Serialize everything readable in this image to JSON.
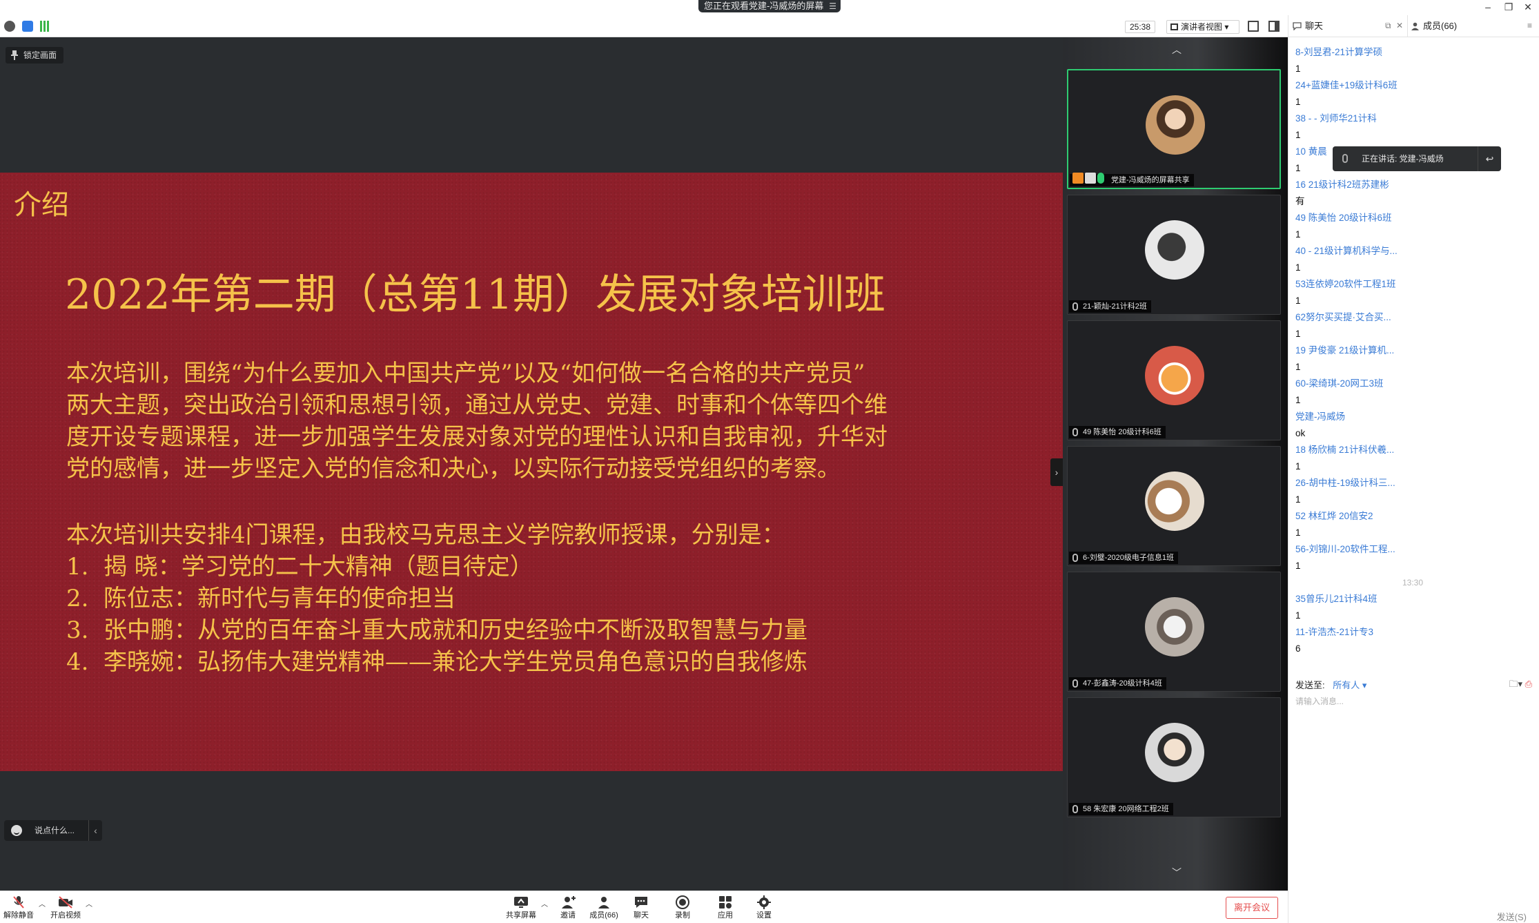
{
  "banner": {
    "text": "您正在观看党建-冯威炀的屏幕",
    "menu_icon": "hamburger-icon"
  },
  "toolbar": {
    "timer": "25:38",
    "view_label": "演讲者视图 ▾"
  },
  "stage": {
    "lock_label": "锁定画面",
    "chat_placeholder": "说点什么..."
  },
  "slide": {
    "heading": "介绍",
    "title": "2022年第二期（总第11期）发展对象培训班",
    "paragraph_lines": [
      "本次培训，围绕“为什么要加入中国共产党”以及“如何做一名合格的共产党员”",
      "两大主题，突出政治引领和思想引领，通过从党史、党建、时事和个体等四个维",
      "度开设专题课程，进一步加强学生发展对象对党的理性认识和自我审视，升华对",
      "党的感情，进一步坚定入党的信念和决心，以实际行动接受党组织的考察。"
    ],
    "intro": "本次培训共安排4门课程，由我校马克思主义学院教师授课，分别是：",
    "courses": [
      {
        "num": "1.",
        "text": "揭    晓：学习党的二十大精神（题目待定）"
      },
      {
        "num": "2.",
        "text": "陈位志：新时代与青年的使命担当"
      },
      {
        "num": "3.",
        "text": "张中鹏：从党的百年奋斗重大成就和历史经验中不断汲取智慧与力量"
      },
      {
        "num": "4.",
        "text": "李晓婉：弘扬伟大建党精神——兼论大学生党员角色意识的自我修炼"
      }
    ]
  },
  "participants": [
    {
      "name": "党建-冯威炀的屏幕共享",
      "avatar_color": "#c89a6a"
    },
    {
      "name": "21-颖灿-21计科2班",
      "avatar_color": "#e8e8e8"
    },
    {
      "name": "49 陈美怡 20级计科6班",
      "avatar_color": "#d85a48"
    },
    {
      "name": "6-刘璧-2020级电子信息1班",
      "avatar_color": "#e6dccf"
    },
    {
      "name": "47-彭鑫涛-20级计科4班",
      "avatar_color": "#b8b0a8"
    },
    {
      "name": "58 朱宏康 20网络工程2班",
      "avatar_color": "#d9d9d9"
    }
  ],
  "bottombar": {
    "unmute": "解除静音",
    "video": "开启视频",
    "share": "共享屏幕",
    "invite": "邀请",
    "members": "成员(66)",
    "chat": "聊天",
    "record": "录制",
    "apps": "应用",
    "settings": "设置",
    "leave": "离开会议"
  },
  "rpanel": {
    "chat_tab": "聊天",
    "members_tab": "成员(66)",
    "speaking": "正在讲话: 党建-冯威炀",
    "send_to_label": "发送至:",
    "send_to_value": "所有人 ▾",
    "input_placeholder": "请输入消息...",
    "send_label": "发送(S)",
    "messages": [
      {
        "t": "sender",
        "v": "8-刘昱君-21计算学硕"
      },
      {
        "t": "body",
        "v": "1"
      },
      {
        "t": "sender",
        "v": "24+蓝婕佳+19级计科6班"
      },
      {
        "t": "body",
        "v": "1"
      },
      {
        "t": "sender",
        "v": "38 - - 刘师华21计科"
      },
      {
        "t": "body",
        "v": "1"
      },
      {
        "t": "sender",
        "v": "10 黄晨"
      },
      {
        "t": "body",
        "v": "1"
      },
      {
        "t": "sender",
        "v": "16 21级计科2班苏建彬"
      },
      {
        "t": "body",
        "v": "有"
      },
      {
        "t": "sender",
        "v": "49 陈美怡 20级计科6班"
      },
      {
        "t": "body",
        "v": "1"
      },
      {
        "t": "sender",
        "v": "40 - 21级计算机科学与..."
      },
      {
        "t": "body",
        "v": "1"
      },
      {
        "t": "sender",
        "v": "53连依婷20软件工程1班"
      },
      {
        "t": "body",
        "v": "1"
      },
      {
        "t": "sender",
        "v": "62努尔买买提·艾合买..."
      },
      {
        "t": "body",
        "v": "1"
      },
      {
        "t": "sender",
        "v": "19 尹俊豪 21级计算机..."
      },
      {
        "t": "body",
        "v": "1"
      },
      {
        "t": "sender",
        "v": "60-梁绮琪-20网工3班"
      },
      {
        "t": "body",
        "v": "1"
      },
      {
        "t": "sender",
        "v": "党建-冯威炀"
      },
      {
        "t": "body",
        "v": "ok"
      },
      {
        "t": "sender",
        "v": "18 杨欣楠 21计科伏羲..."
      },
      {
        "t": "body",
        "v": "1"
      },
      {
        "t": "sender",
        "v": "26-胡中柱-19级计科三..."
      },
      {
        "t": "body",
        "v": "1"
      },
      {
        "t": "sender",
        "v": "52 林红烨 20信安2"
      },
      {
        "t": "body",
        "v": "1"
      },
      {
        "t": "sender",
        "v": "56-刘锦川-20软件工程..."
      },
      {
        "t": "body",
        "v": "1"
      },
      {
        "t": "time",
        "v": "13:30"
      },
      {
        "t": "sender",
        "v": "35曾乐儿21计科4班"
      },
      {
        "t": "body",
        "v": "1"
      },
      {
        "t": "sender",
        "v": "11-许浩杰-21计专3"
      },
      {
        "t": "body",
        "v": "6"
      }
    ]
  }
}
